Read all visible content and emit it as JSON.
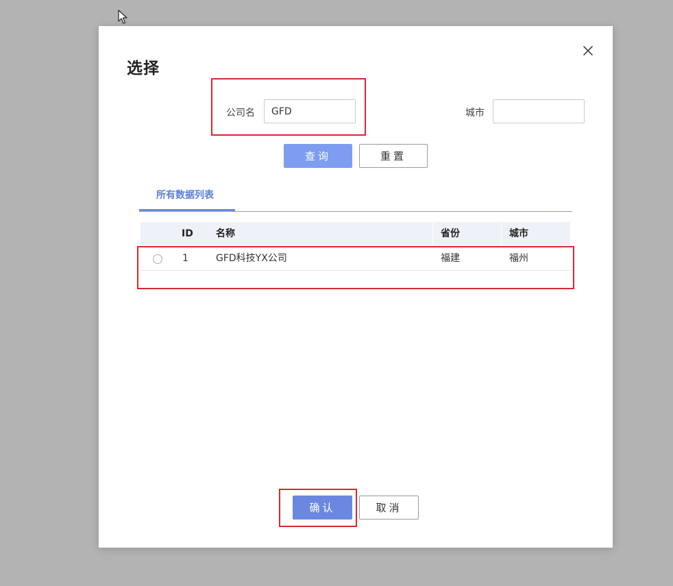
{
  "dialog": {
    "title": "选择",
    "close_icon": "close-icon"
  },
  "search": {
    "company_label": "公司名",
    "company_value": "GFD",
    "city_label": "城市",
    "city_value": "",
    "query_label": "查询",
    "reset_label": "重置"
  },
  "tabs": [
    {
      "label": "所有数据列表",
      "active": true
    }
  ],
  "table": {
    "headers": {
      "id": "ID",
      "name": "名称",
      "province": "省份",
      "city": "城市"
    },
    "rows": [
      {
        "selected": false,
        "id": "1",
        "name": "GFD科技YX公司",
        "province": "福建",
        "city": "福州"
      }
    ]
  },
  "footer": {
    "confirm_label": "确认",
    "cancel_label": "取消"
  },
  "colors": {
    "overlay": "#b3b3b3",
    "primary": "#6b88e0",
    "query_button": "#7d9ef0",
    "highlight_box": "#d9272e",
    "active_tab": "#5b7fd6"
  }
}
